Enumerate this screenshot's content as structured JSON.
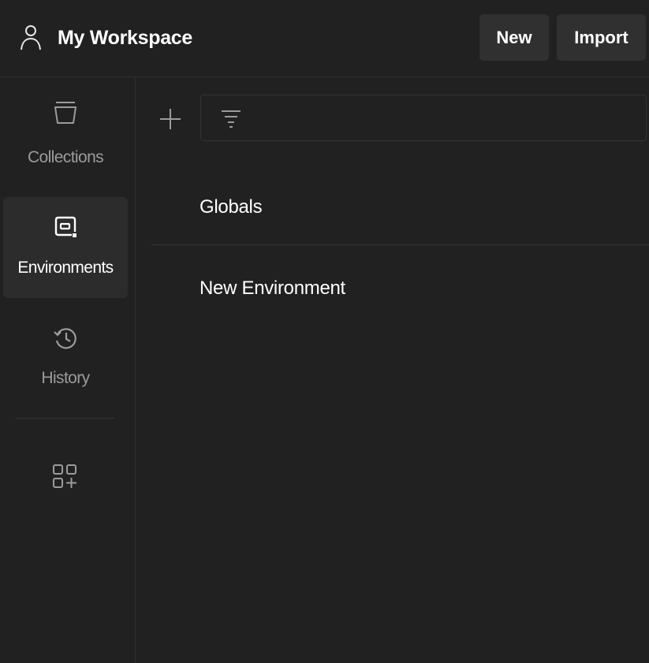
{
  "header": {
    "workspace_icon": "user-icon",
    "workspace_title": "My Workspace",
    "new_label": "New",
    "import_label": "Import"
  },
  "sidebar": {
    "items": [
      {
        "label": "Collections",
        "icon": "collections-icon",
        "active": false
      },
      {
        "label": "Environments",
        "icon": "environments-icon",
        "active": true
      },
      {
        "label": "History",
        "icon": "history-icon",
        "active": false
      }
    ],
    "extra_icon": "add-apps-icon"
  },
  "main": {
    "add_icon": "plus-icon",
    "filter_icon": "filter-icon",
    "filter_value": "",
    "environments": [
      {
        "name": "Globals"
      },
      {
        "name": "New Environment"
      }
    ]
  },
  "colors": {
    "background": "#212121",
    "surface": "#303030",
    "active_item": "#2c2c2c",
    "text_primary": "#ffffff",
    "text_secondary": "#9b9b9b"
  }
}
